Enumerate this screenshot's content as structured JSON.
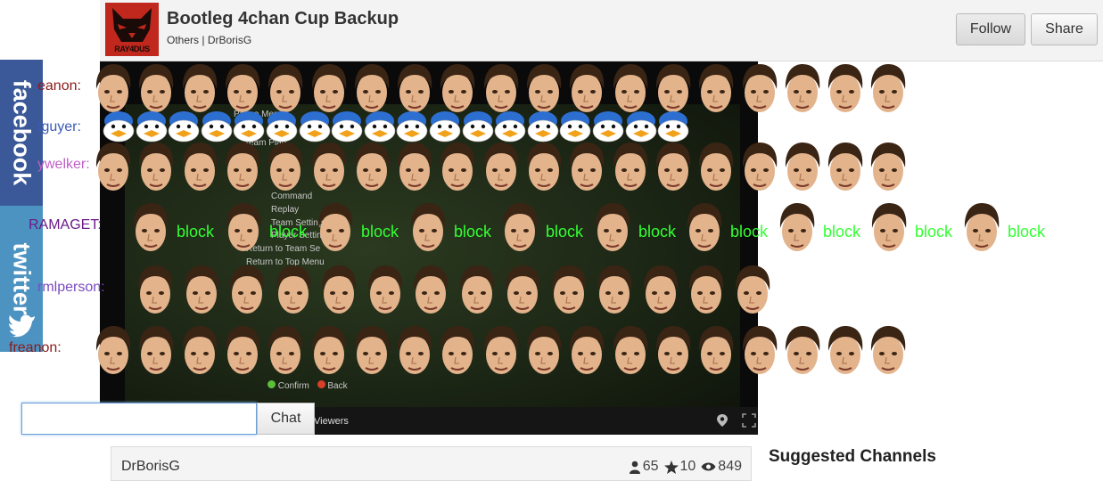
{
  "header": {
    "logo_text": "RAY4DUS",
    "title": "Bootleg 4chan Cup Backup",
    "category": "Others",
    "separator": "|",
    "owner": "DrBorisG",
    "follow_label": "Follow",
    "share_label": "Share"
  },
  "player": {
    "menu_lines": [
      "Pause Menu",
      "Team Plan",
      "Command",
      "Replay",
      "Team Settings",
      "Player Settings",
      "Return to Team Se",
      "Return to Top Menu"
    ],
    "confirm_label": "Confirm",
    "back_label": "Back",
    "viewers_label": "Viewers",
    "icons": [
      "location-pin-icon",
      "fullscreen-icon"
    ]
  },
  "chat_messages": [
    {
      "name": "eanon:",
      "color": "#8b1a1a",
      "content": "face-emotes"
    },
    {
      "name": "tguyer:",
      "color": "#3a5ab8",
      "content": "duck-emotes"
    },
    {
      "name": "ywelker:",
      "color": "#c060c8",
      "content": "face-emotes"
    },
    {
      "name": "RAMAGET:",
      "color": "#6b1a8a",
      "content": "face-block-emotes",
      "block_text": "block"
    },
    {
      "name": "rmlperson:",
      "color": "#7a4ac0",
      "content": "face-emotes"
    },
    {
      "name": "freanon:",
      "color": "#8b1a1a",
      "content": "face-emotes"
    }
  ],
  "social": {
    "facebook_label": "facebook",
    "twitter_label": "twitter"
  },
  "chat": {
    "input_value": "",
    "placeholder": "",
    "button_label": "Chat"
  },
  "owner_bar": {
    "name": "DrBorisG",
    "followers": "65",
    "favorites": "10",
    "views": "849"
  },
  "suggested": {
    "title": "Suggested Channels"
  },
  "colors": {
    "facebook": "#3b5998",
    "twitter": "#4d93c2",
    "block": "#33ff33",
    "header_bg": "#f3f3f3"
  }
}
